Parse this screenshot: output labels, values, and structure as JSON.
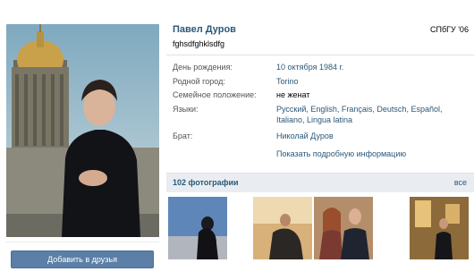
{
  "profile": {
    "name": "Павел Дуров",
    "status": "fghsdfghklsdfg",
    "university": "СПбГУ '06"
  },
  "info": {
    "rows": [
      {
        "label": "День рождения:",
        "value": "10 октября 1984 г."
      },
      {
        "label": "Родной город:",
        "value": "Torino"
      },
      {
        "label": "Семейное положение:",
        "value": "не женат"
      },
      {
        "label": "Языки:",
        "value": "Русский, English, Français, Deutsch, Español, Italiano, Lingua latina"
      },
      {
        "label": "Брат:",
        "value": "Николай Дуров"
      }
    ],
    "show_more": "Показать подробную информацию"
  },
  "actions": {
    "add_friend": "Добавить в друзья"
  },
  "photos": {
    "title": "102 фотографии",
    "all_link": "все",
    "thumbnails": [
      "photo-1",
      "photo-2",
      "photo-3",
      "photo-4",
      "photo-5"
    ]
  },
  "colors": {
    "link": "#2b587a",
    "button": "#5b7fa6",
    "photos_header_bg": "#e9edf1"
  }
}
